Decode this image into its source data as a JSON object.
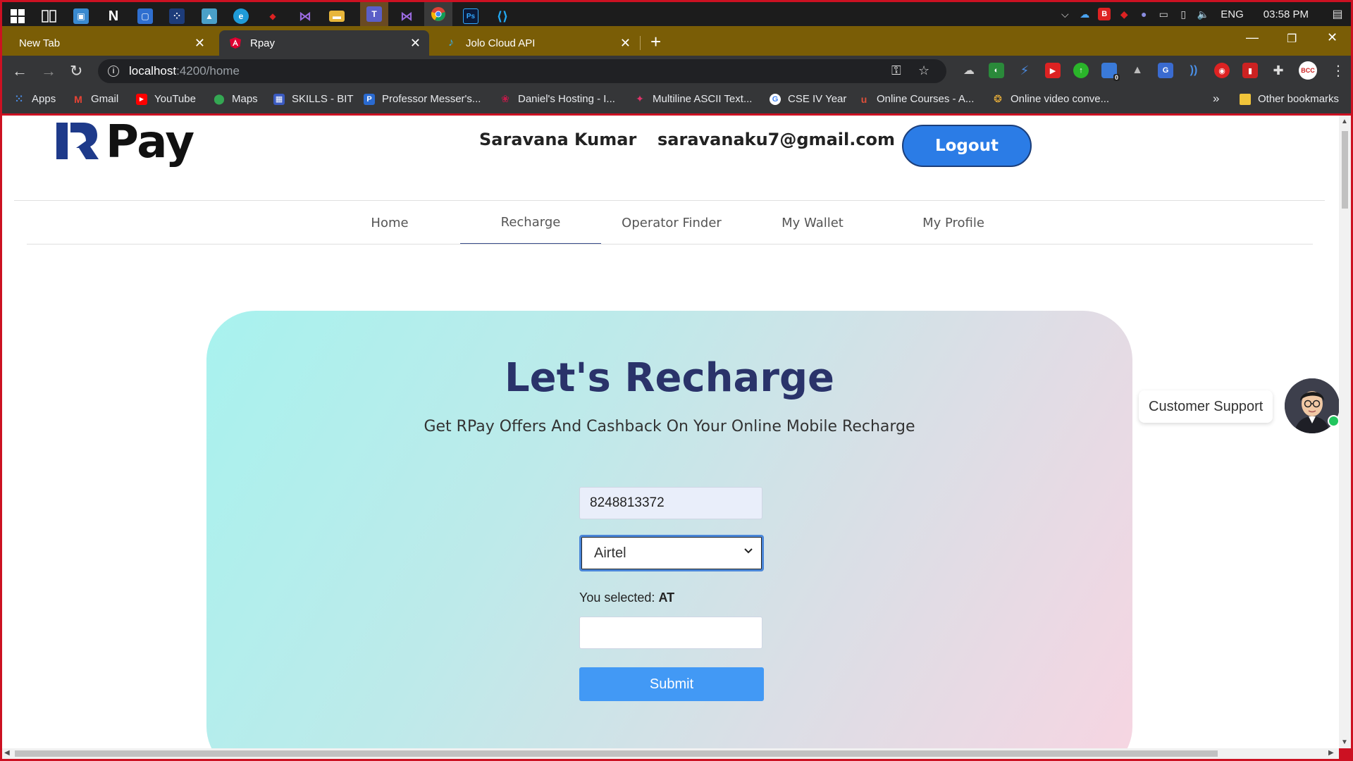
{
  "taskbar": {
    "time": "03:58 PM",
    "language": "ENG"
  },
  "tabs": [
    {
      "label": "New Tab"
    },
    {
      "label": "Rpay"
    },
    {
      "label": "Jolo Cloud API"
    }
  ],
  "address": {
    "host": "localhost",
    "path": ":4200/home"
  },
  "bookmarks": [
    {
      "label": "Apps"
    },
    {
      "label": "Gmail"
    },
    {
      "label": "YouTube"
    },
    {
      "label": "Maps"
    },
    {
      "label": "SKILLS - BIT"
    },
    {
      "label": "Professor Messer's..."
    },
    {
      "label": "Daniel's Hosting - I..."
    },
    {
      "label": "Multiline ASCII Text..."
    },
    {
      "label": "CSE IV Year"
    },
    {
      "label": "Online Courses - A..."
    },
    {
      "label": "Online video conve..."
    }
  ],
  "bookmarks_overflow": "»",
  "other_bookmarks": "Other bookmarks",
  "extension_badge": "0",
  "profile_badge": "BCC",
  "page": {
    "logo_text": "Pay",
    "user_name": "Saravana Kumar",
    "user_email": "saravanaku7@gmail.com",
    "logout_label": "Logout",
    "nav": [
      "Home",
      "Recharge",
      "Operator Finder",
      "My Wallet",
      "My Profile"
    ],
    "active_nav": "Recharge",
    "card": {
      "title": "Let's Recharge",
      "subtitle": "Get RPay Offers And Cashback On Your Online Mobile Recharge",
      "phone_value": "8248813372",
      "operator_selected": "Airtel",
      "selected_prefix": "You selected:",
      "selected_code": "AT",
      "amount_value": "",
      "submit_label": "Submit"
    },
    "support_label": "Customer Support"
  }
}
